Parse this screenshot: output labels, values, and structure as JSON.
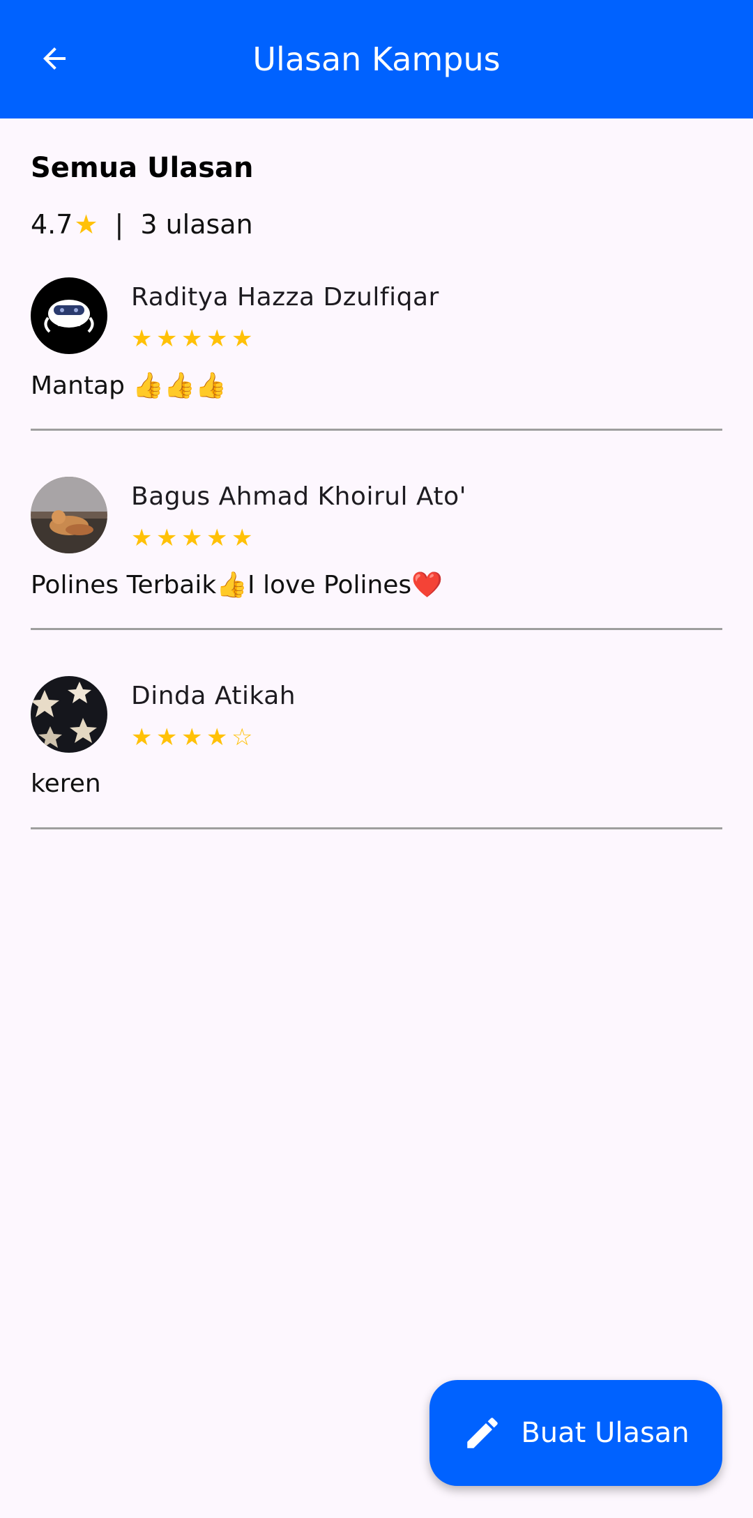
{
  "appbar": {
    "title": "Ulasan Kampus",
    "back_icon": "arrow-left-icon",
    "color": "#0062FF"
  },
  "section": {
    "title": "Semua Ulasan",
    "rating": "4.7",
    "star": "★",
    "separator": "|",
    "count_label": "3 ulasan"
  },
  "reviews": [
    {
      "name": "Raditya Hazza Dzulfiqar",
      "rating": 5,
      "comment": "Mantap 👍👍👍",
      "avatar": "robot-avatar"
    },
    {
      "name": "Bagus Ahmad Khoirul Ato'",
      "rating": 5,
      "comment": "Polines Terbaik👍I love Polines❤️",
      "avatar": "cat-photo-avatar"
    },
    {
      "name": "Dinda Atikah",
      "rating": 4,
      "comment": "keren",
      "avatar": "stars-pattern-avatar"
    }
  ],
  "fab": {
    "label": "Buat Ulasan",
    "icon": "pencil-icon"
  },
  "colors": {
    "star": "#FFC107",
    "background": "#FDF7FE"
  }
}
